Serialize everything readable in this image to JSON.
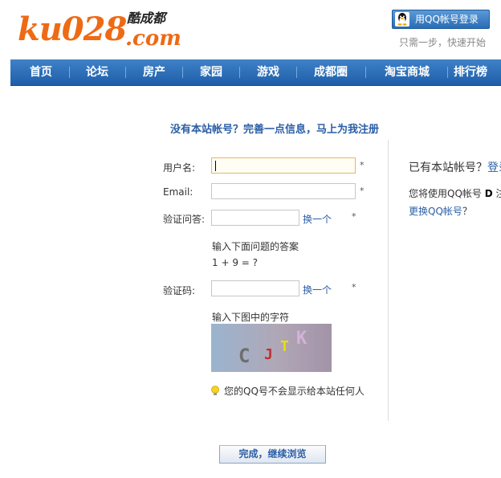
{
  "header": {
    "logo_main": "ku028",
    "logo_cn": "酷成都",
    "logo_domain": ".com",
    "qq_login_label": "用QQ帐号登录",
    "qq_tip": "只需一步，快速开始"
  },
  "nav": {
    "items": [
      "首页",
      "论坛",
      "房产",
      "家园",
      "游戏",
      "成都圈",
      "淘宝商城",
      "排行榜"
    ]
  },
  "form": {
    "headline": "没有本站帐号？完善一点信息，马上为我注册",
    "username_label": "用户名:",
    "username_value": "",
    "email_label": "Email:",
    "email_value": "",
    "question_label": "验证问答:",
    "question_change": "换一个",
    "question_hint": "输入下面问题的答案",
    "question_text": "1 + 9 = ?",
    "captcha_label": "验证码:",
    "captcha_change": "换一个",
    "captcha_hint": "输入下图中的字符",
    "captcha_chars": [
      "C",
      "J",
      "T",
      "K"
    ],
    "required_mark": "*",
    "privacy_note": "您的QQ号不会显示给本站任何人",
    "submit_label": "完成，继续浏览"
  },
  "right_panel": {
    "has_account_text": "已有本站帐号？",
    "login_link": "登录",
    "will_use_prefix": "您将使用QQ帐号",
    "will_use_name": "D",
    "will_use_suffix": "注",
    "switch_qq_link": "更换QQ帐号",
    "switch_qq_suffix": "？"
  },
  "colors": {
    "brand_orange": "#ee6a14",
    "nav_blue": "#2a6db5",
    "link_blue": "#2b5ea6"
  }
}
